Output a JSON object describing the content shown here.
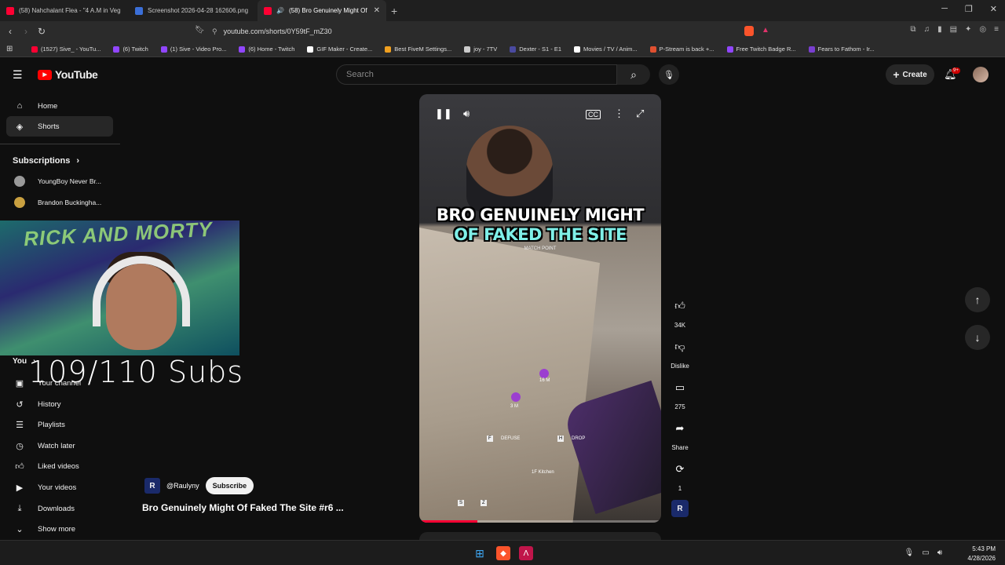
{
  "browser": {
    "tabs": [
      {
        "label": "(58) Nahchalant Flea - \"4 A.M in Veg",
        "color": "#ff0033"
      },
      {
        "label": "Screenshot 2026-04-28 162606.png",
        "color": "#3b6fd8"
      },
      {
        "label": "(58) Bro Genuinely Might Of F",
        "color": "#ff0033"
      }
    ],
    "new_tab": "+",
    "url": "youtube.com/shorts/0Y59tF_mZ30",
    "bookmarks": [
      {
        "label": "(1527) Sive_ - YouTu...",
        "color": "#ff0033"
      },
      {
        "label": "(6) Twitch",
        "color": "#9146ff"
      },
      {
        "label": "(1) Sive - Video Pro...",
        "color": "#9146ff"
      },
      {
        "label": "(6) Home - Twitch",
        "color": "#9146ff"
      },
      {
        "label": "GIF Maker - Create...",
        "color": "#ffffff"
      },
      {
        "label": "Best FiveM Settings...",
        "color": "#f0a020"
      },
      {
        "label": "joy - 7TV",
        "color": "#cccccc"
      },
      {
        "label": "Dexter - S1 - E1",
        "color": "#4a4aa0"
      },
      {
        "label": "Movies / TV / Anim...",
        "color": "#ffffff"
      },
      {
        "label": "P-Stream is back +...",
        "color": "#e05030"
      },
      {
        "label": "Free Twitch Badge R...",
        "color": "#9146ff"
      },
      {
        "label": "Fears to Fathom - Ir...",
        "color": "#7a3fd0"
      }
    ]
  },
  "header": {
    "logo": "YouTube",
    "search_placeholder": "Search",
    "create_label": "Create",
    "notifications": "9+"
  },
  "sidebar": {
    "items": [
      {
        "label": "Home",
        "icon": "home-icon",
        "glyph": "⌂"
      },
      {
        "label": "Shorts",
        "icon": "shorts-icon",
        "glyph": "◈"
      }
    ],
    "subscriptions_title": "Subscriptions",
    "subscriptions": [
      {
        "label": "YoungBoy Never Br..."
      },
      {
        "label": "Brandon Buckingha..."
      }
    ],
    "you_title": "You",
    "you_items": [
      {
        "label": "Your channel",
        "glyph": "▣"
      },
      {
        "label": "History",
        "glyph": "↺"
      },
      {
        "label": "Playlists",
        "glyph": "☰"
      },
      {
        "label": "Watch later",
        "glyph": "◷"
      },
      {
        "label": "Liked videos",
        "glyph": "👍"
      },
      {
        "label": "Your videos",
        "glyph": "▶"
      },
      {
        "label": "Downloads",
        "glyph": "⤓"
      },
      {
        "label": "Show more",
        "glyph": "⌄"
      }
    ]
  },
  "overlay": {
    "webcam_graffiti": "RICK AND MORTY",
    "subs_text": "109/110 Subs"
  },
  "short": {
    "caption_line1": "BRO GENUINELY MIGHT",
    "caption_line2": "OF FAKED THE SITE",
    "match_point": "MATCH POINT",
    "hud": {
      "marker1": "16 M",
      "marker2": "3 M",
      "defuse": "DEFUSE",
      "drop": "DROP",
      "location": "1F Kitchen",
      "key_f": "F",
      "key_h": "H",
      "key_s": "S",
      "key_z": "Z"
    },
    "progress_fraction": 0.24,
    "channel": "@Raulyny",
    "subscribe_label": "Subscribe",
    "title": "Bro Genuinely Might Of Faked The Site #r6 ...",
    "likes": "34K",
    "dislike_label": "Dislike",
    "comments": "275",
    "share_label": "Share",
    "remix_count": "1"
  },
  "taskbar": {
    "time": "5:43 PM",
    "date": "4/28/2026"
  }
}
